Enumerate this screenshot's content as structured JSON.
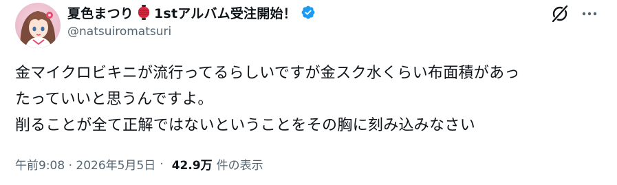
{
  "author": {
    "name_prefix": "夏色まつり",
    "name_suffix": "1stアルバム受注開始！",
    "handle": "@natsuiromatsuri",
    "lantern_icon": "red-lantern-emoji",
    "verified_icon": "verified-badge-icon",
    "verified_color": "#1d9bf0"
  },
  "actions": {
    "grok_icon": "grok-icon",
    "more_icon": "more-horizontal-icon"
  },
  "tweet": {
    "lines": [
      "金マイクロビキニが流行ってるらしいですが金スク水くらい布面積があっ",
      "たっていいと思うんですよ。",
      "削ることが全て正解ではないということをその胸に刻み込みなさい"
    ]
  },
  "meta": {
    "time": "午前9:08 · 2026年5月5日",
    "separator": "·",
    "views": "42.9万",
    "views_label": "件の表示"
  },
  "colors": {
    "text_primary": "#0f1419",
    "text_secondary": "#536471",
    "accent": "#1d9bf0",
    "lantern_red": "#d7263d"
  }
}
